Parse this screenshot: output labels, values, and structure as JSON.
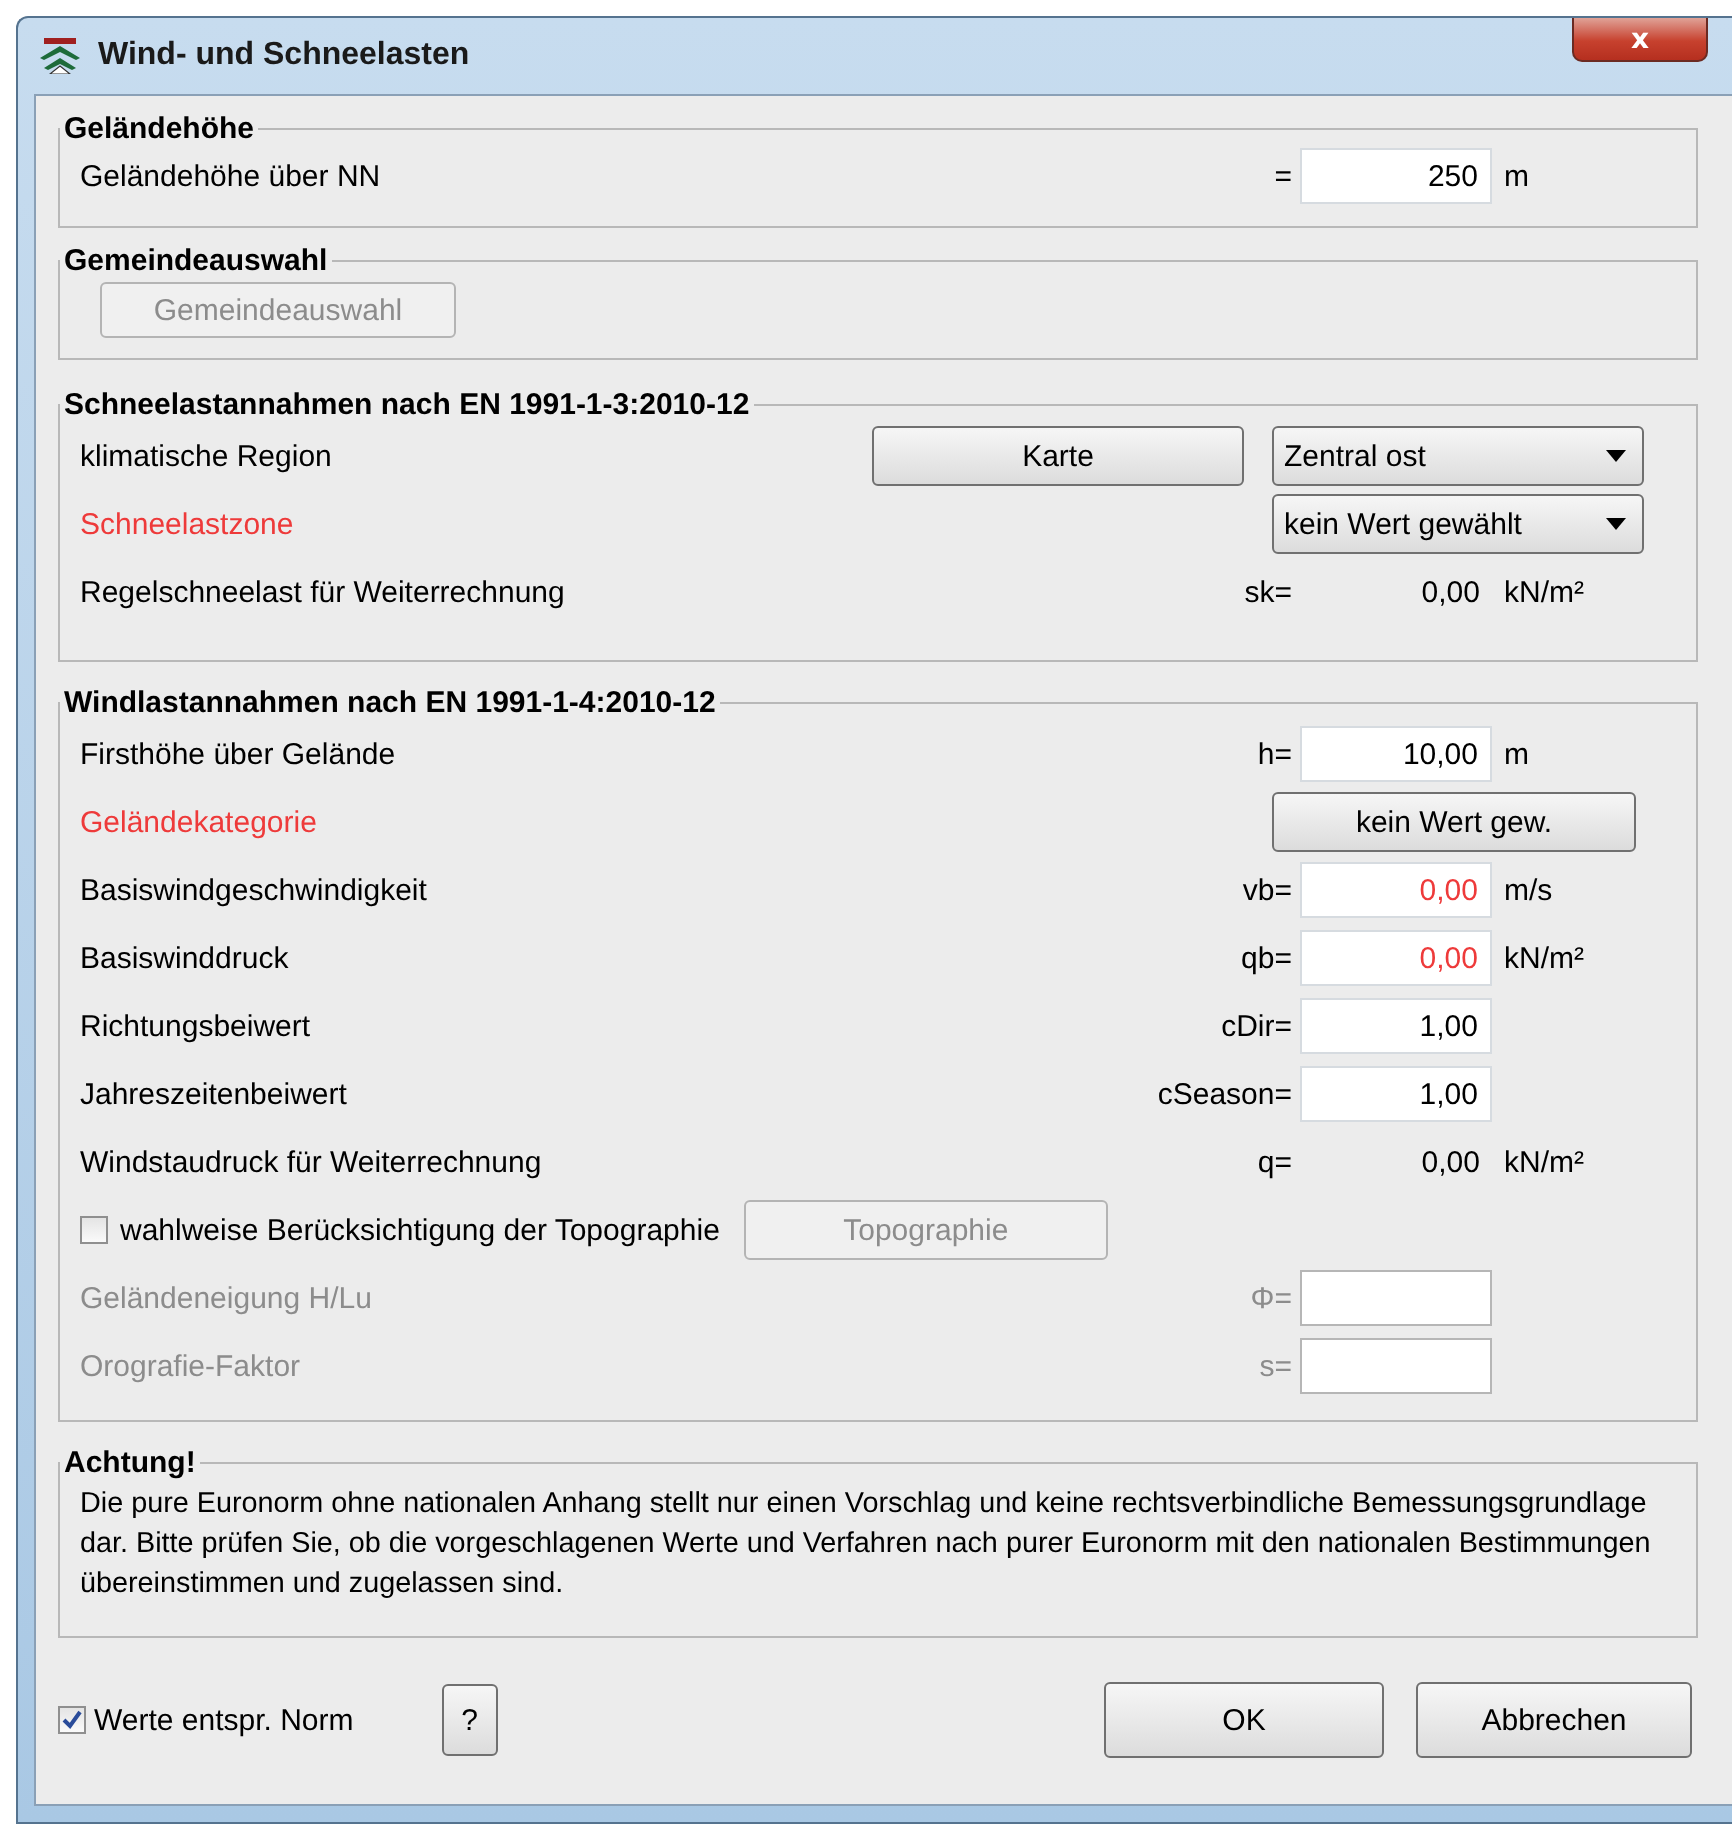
{
  "window": {
    "title": "Wind- und Schneelasten",
    "close": "x"
  },
  "sections": [
    {
      "title": "Geländehöhe",
      "rows": [
        {
          "kind": "field",
          "label": "Geländehöhe über NN",
          "symbol": "=",
          "value": "250",
          "unit": "m",
          "label_warning": false,
          "value_warning": false,
          "disabled": false
        }
      ]
    },
    {
      "title": "Gemeindeauswahl",
      "rows": [
        {
          "kind": "button_only",
          "button": "Gemeindeauswahl",
          "disabled": true
        }
      ]
    },
    {
      "title": "Schneelastannahmen nach EN 1991-1-3:2010-12",
      "rows": [
        {
          "kind": "select",
          "label": "klimatische Region",
          "label_warning": false,
          "button": "Karte",
          "select": "Zentral ost"
        },
        {
          "kind": "select",
          "label": "Schneelastzone",
          "label_warning": true,
          "select": "kein Wert gewählt"
        },
        {
          "kind": "readout",
          "label": "Regelschneelast für Weiterrechnung",
          "symbol": "sk=",
          "value": "0,00",
          "unit": "kN/m²"
        }
      ]
    },
    {
      "title": "Windlastannahmen nach EN 1991-1-4:2010-12",
      "rows": [
        {
          "kind": "field",
          "label": "Firsthöhe über Gelände",
          "symbol": "h=",
          "value": "10,00",
          "unit": "m",
          "label_warning": false,
          "value_warning": false,
          "disabled": false
        },
        {
          "kind": "button",
          "label": "Geländekategorie",
          "label_warning": true,
          "button": "kein Wert gew."
        },
        {
          "kind": "field",
          "label": "Basiswindgeschwindigkeit",
          "symbol": "vb=",
          "value": "0,00",
          "unit": "m/s",
          "label_warning": false,
          "value_warning": true,
          "disabled": false
        },
        {
          "kind": "field",
          "label": "Basiswinddruck",
          "symbol": "qb=",
          "value": "0,00",
          "unit": "kN/m²",
          "label_warning": false,
          "value_warning": true,
          "disabled": false
        },
        {
          "kind": "field",
          "label": "Richtungsbeiwert",
          "symbol": "cDir=",
          "value": "1,00",
          "label_warning": false,
          "value_warning": false,
          "disabled": false
        },
        {
          "kind": "field",
          "label": "Jahreszeitenbeiwert",
          "symbol": "cSeason=",
          "value": "1,00",
          "label_warning": false,
          "value_warning": false,
          "disabled": false
        },
        {
          "kind": "readout",
          "label": "Windstaudruck für Weiterrechnung",
          "symbol": "q=",
          "value": "0,00",
          "unit": "kN/m²"
        },
        {
          "kind": "checkbox",
          "label": "wahlweise Berücksichtigung der Topographie",
          "checked": false,
          "button": "Topographie",
          "disabled": true
        },
        {
          "kind": "field",
          "label": "Geländeneigung H/Lu",
          "symbol": "Φ=",
          "label_warning": false,
          "value_warning": false,
          "disabled": true
        },
        {
          "kind": "field",
          "label": "Orografie-Faktor",
          "symbol": "s=",
          "label_warning": false,
          "value_warning": false,
          "disabled": true
        }
      ]
    },
    {
      "title": "Achtung!",
      "rows": [
        {
          "kind": "note",
          "text": "Die pure Euronorm ohne nationalen Anhang stellt nur einen Vorschlag und keine rechtsverbindliche Bemessungsgrundlage dar. Bitte prüfen Sie, ob die vorgeschlagenen Werte und Verfahren nach purer Euronorm mit den nationalen Bestimmungen übereinstimmen und zugelassen sind."
        }
      ]
    }
  ],
  "footer": {
    "checkbox": {
      "label": "Werte entspr. Norm",
      "checked": true
    },
    "help": "?",
    "buttons": [
      "OK",
      "Abbrechen"
    ]
  }
}
